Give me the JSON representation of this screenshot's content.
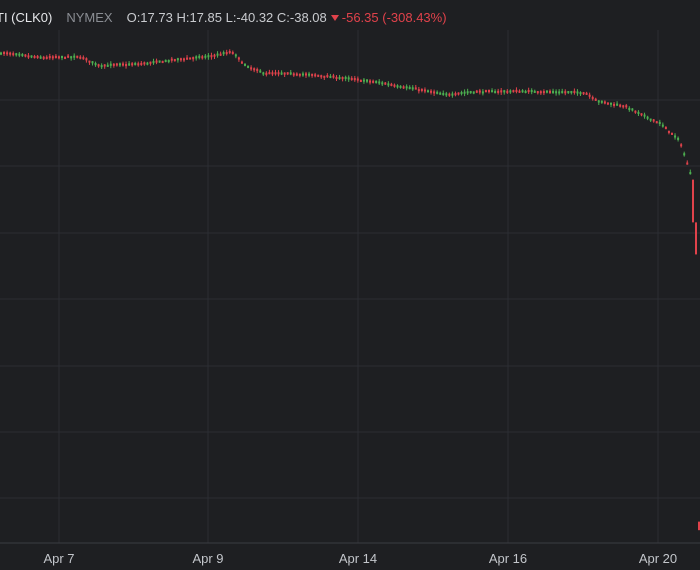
{
  "header": {
    "symbol": "TI (CLK0)",
    "exchange": "NYMEX",
    "ohlc": "O:17.73 H:17.85 L:-40.32 C:-38.08",
    "change": "-56.35 (-308.43%)",
    "change_icon": "down-triangle-icon"
  },
  "colors": {
    "background": "#1e1f22",
    "grid": "#2c2e33",
    "up": "#4caf50",
    "down": "#e0424b",
    "text": "#c9cbcf"
  },
  "chart_data": {
    "type": "candlestick",
    "title": "",
    "xlabel": "",
    "ylabel": "",
    "x_tick_labels": [
      "Apr 7",
      "Apr 9",
      "Apr 14",
      "Apr 16",
      "Apr 20"
    ],
    "y_axis_visible": false,
    "ylim": [
      -43,
      29
    ],
    "grid": true,
    "anchor_points": [
      {
        "tick": "Apr 7",
        "price": 24.6
      },
      {
        "tick": "Apr 9",
        "price": 25.4
      },
      {
        "tick": "Apr 14",
        "price": 22.0
      },
      {
        "tick": "Apr 16",
        "price": 20.0
      },
      {
        "tick": "Apr 20",
        "price": 13.5
      }
    ],
    "last_session": {
      "open": 17.73,
      "high": 17.85,
      "low": -40.32,
      "close": -38.08
    }
  }
}
